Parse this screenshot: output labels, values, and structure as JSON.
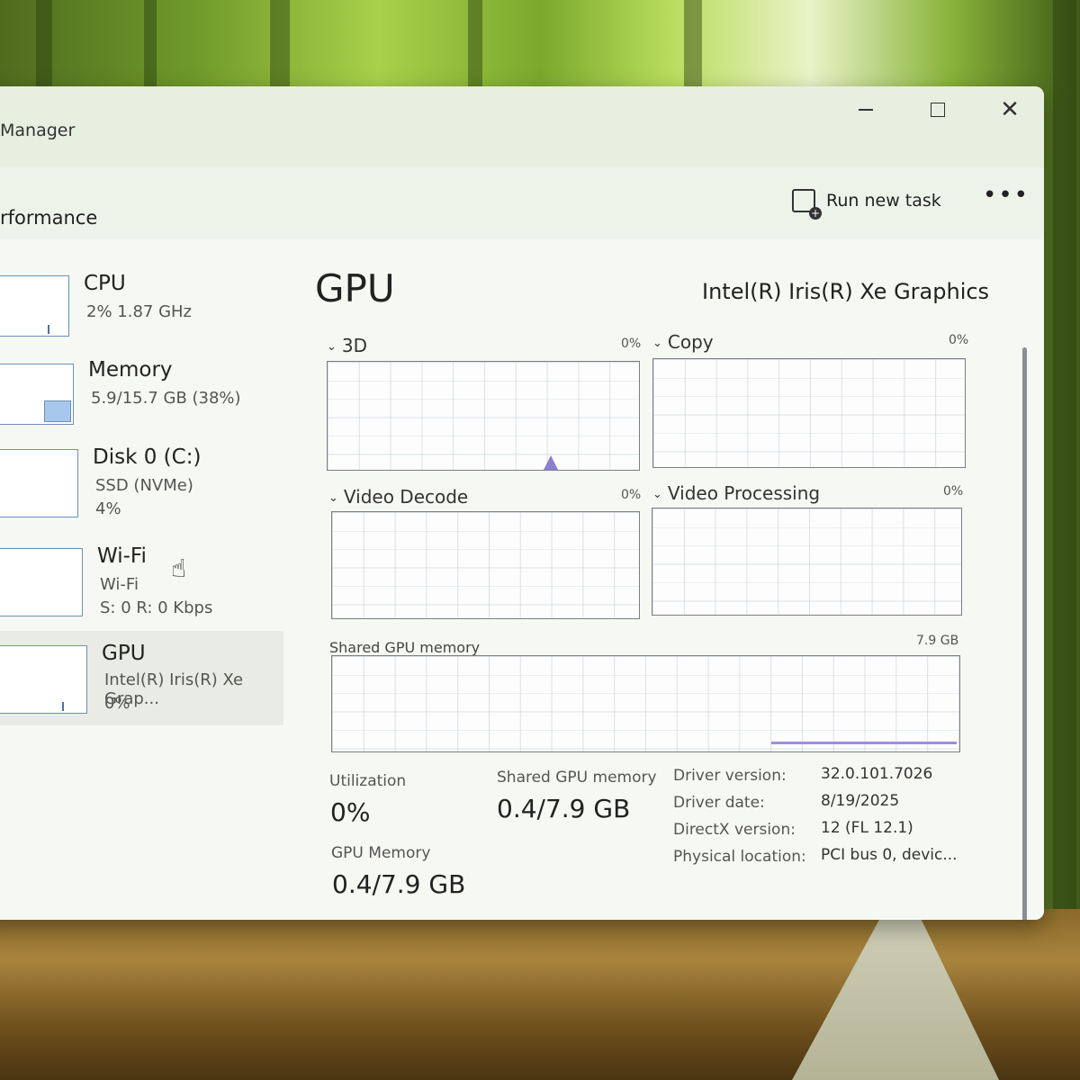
{
  "window": {
    "title": "Manager",
    "section": "rformance",
    "run_new_task": "Run new task",
    "more": "•••",
    "close": "✕"
  },
  "sidebar": [
    {
      "name": "CPU",
      "line1": "2% 1.87 GHz",
      "line2": ""
    },
    {
      "name": "Memory",
      "line1": "5.9/15.7 GB (38%)",
      "line2": ""
    },
    {
      "name": "Disk 0 (C:)",
      "line1": "SSD (NVMe)",
      "line2": "4%"
    },
    {
      "name": "Wi-Fi",
      "line1": "Wi-Fi",
      "line2": "S: 0 R: 0 Kbps"
    },
    {
      "name": "GPU",
      "line1": "Intel(R) Iris(R) Xe Grap...",
      "line2": "0%"
    }
  ],
  "main": {
    "title": "GPU",
    "model": "Intel(R) Iris(R) Xe Graphics",
    "graphs": [
      {
        "label": "3D",
        "percent": "0%"
      },
      {
        "label": "Copy",
        "percent": "0%"
      },
      {
        "label": "Video Decode",
        "percent": "0%"
      },
      {
        "label": "Video Processing",
        "percent": "0%"
      }
    ],
    "shared_memory": {
      "label": "Shared GPU memory",
      "max": "7.9 GB"
    },
    "stats": {
      "utilization_label": "Utilization",
      "utilization_value": "0%",
      "shared_label": "Shared GPU memory",
      "shared_value": "0.4/7.9 GB",
      "gpu_memory_label": "GPU Memory",
      "gpu_memory_value": "0.4/7.9 GB"
    },
    "info": [
      {
        "key": "Driver version:",
        "value": "32.0.101.7026"
      },
      {
        "key": "Driver date:",
        "value": "8/19/2025"
      },
      {
        "key": "DirectX version:",
        "value": "12 (FL 12.1)"
      },
      {
        "key": "Physical location:",
        "value": "PCI bus 0, devic..."
      }
    ]
  },
  "icons": {
    "run_task": "run-task-icon",
    "chevron": "chevron-down-icon",
    "cursor": "hand-pointer-icon"
  }
}
